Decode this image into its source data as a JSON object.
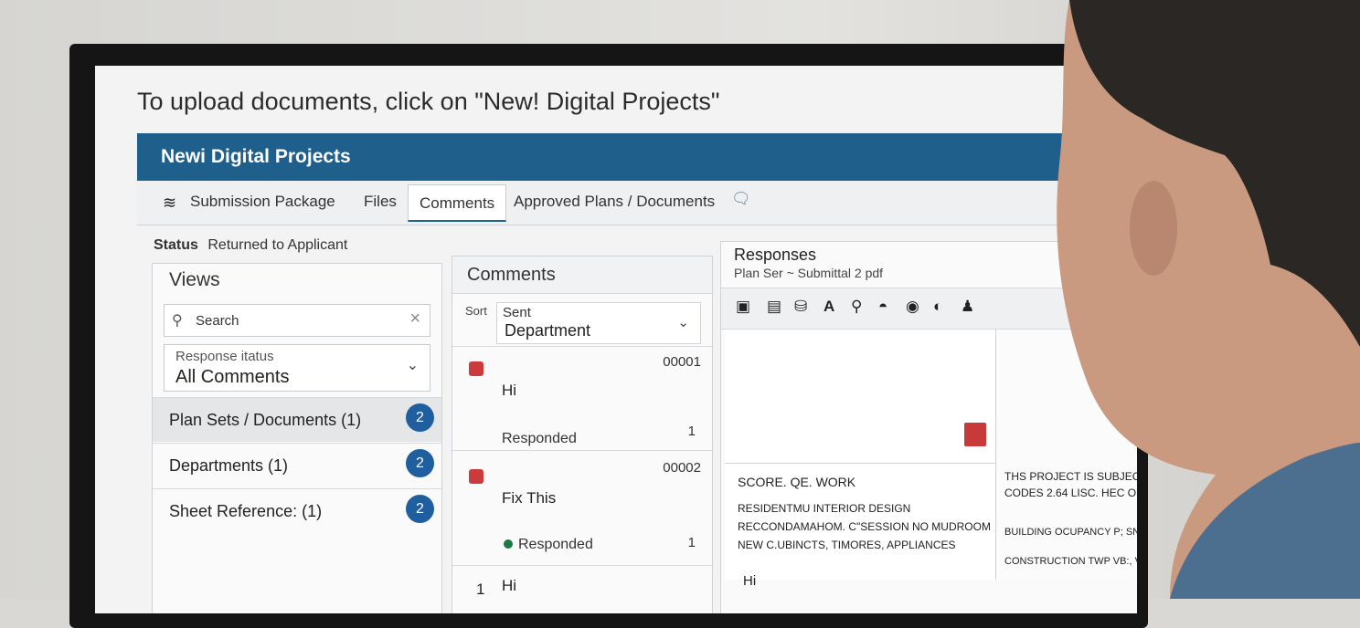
{
  "instruction": "To upload documents, click on \"New! Digital Projects\"",
  "banner": {
    "title": "Newi Digital Projects"
  },
  "tabs": {
    "submission_package": "Submission Package",
    "files": "Files",
    "comments": "Comments",
    "approved": "Approved Plans / Documents"
  },
  "status": {
    "label": "Status",
    "value": "Returned to Applicant"
  },
  "views": {
    "title": "Views",
    "search_placeholder": "Search",
    "filter_label": "Response itatus",
    "filter_value": "All Comments",
    "items": [
      {
        "label": "Plan Sets / Documents (1)",
        "badge": "2"
      },
      {
        "label": "Departments (1)",
        "badge": "2"
      },
      {
        "label": "Sheet Reference: (1)",
        "badge": "2"
      }
    ]
  },
  "comments": {
    "title": "Comments",
    "sort_label": "Sort",
    "sort_line1": "Sent",
    "sort_line2": "Department",
    "items": [
      {
        "id": "00001",
        "text": "Hi",
        "status": "Responded",
        "count": "1"
      },
      {
        "id": "00002",
        "text": "Fix This",
        "status": "Responded",
        "count": "1"
      },
      {
        "num": "1",
        "text": "Hi"
      }
    ]
  },
  "responses": {
    "title": "Responses",
    "subtitle": "Plan Ser ~ Submittal 2 pdf",
    "scope_heading": "SCORE. QE. WORK",
    "scope_line1": "RESIDENTMU INTERIOR DESIGN",
    "scope_line2": "RECCONDAMAHOM. C\"SESSION NO MUDROOM",
    "scope_line3": "NEW C.UBINCTS, TIMORES, APPLIANCES",
    "reply": "Hi",
    "right_line1": "THS PROJECT IS SUBJECT SO",
    "right_line2": "CODES 2.64 LISC. HEC ONC.C",
    "right_line3": "BUILDING OCUPANCY P; SNGLE FAM",
    "right_line4": "CONSTRUCTION TWP VB:, VIDEO FR"
  },
  "colors": {
    "banner": "#1f5f8b",
    "badge": "#1f5fa0",
    "flag": "#cc3b3b",
    "responded_dot": "#1e7a42"
  }
}
